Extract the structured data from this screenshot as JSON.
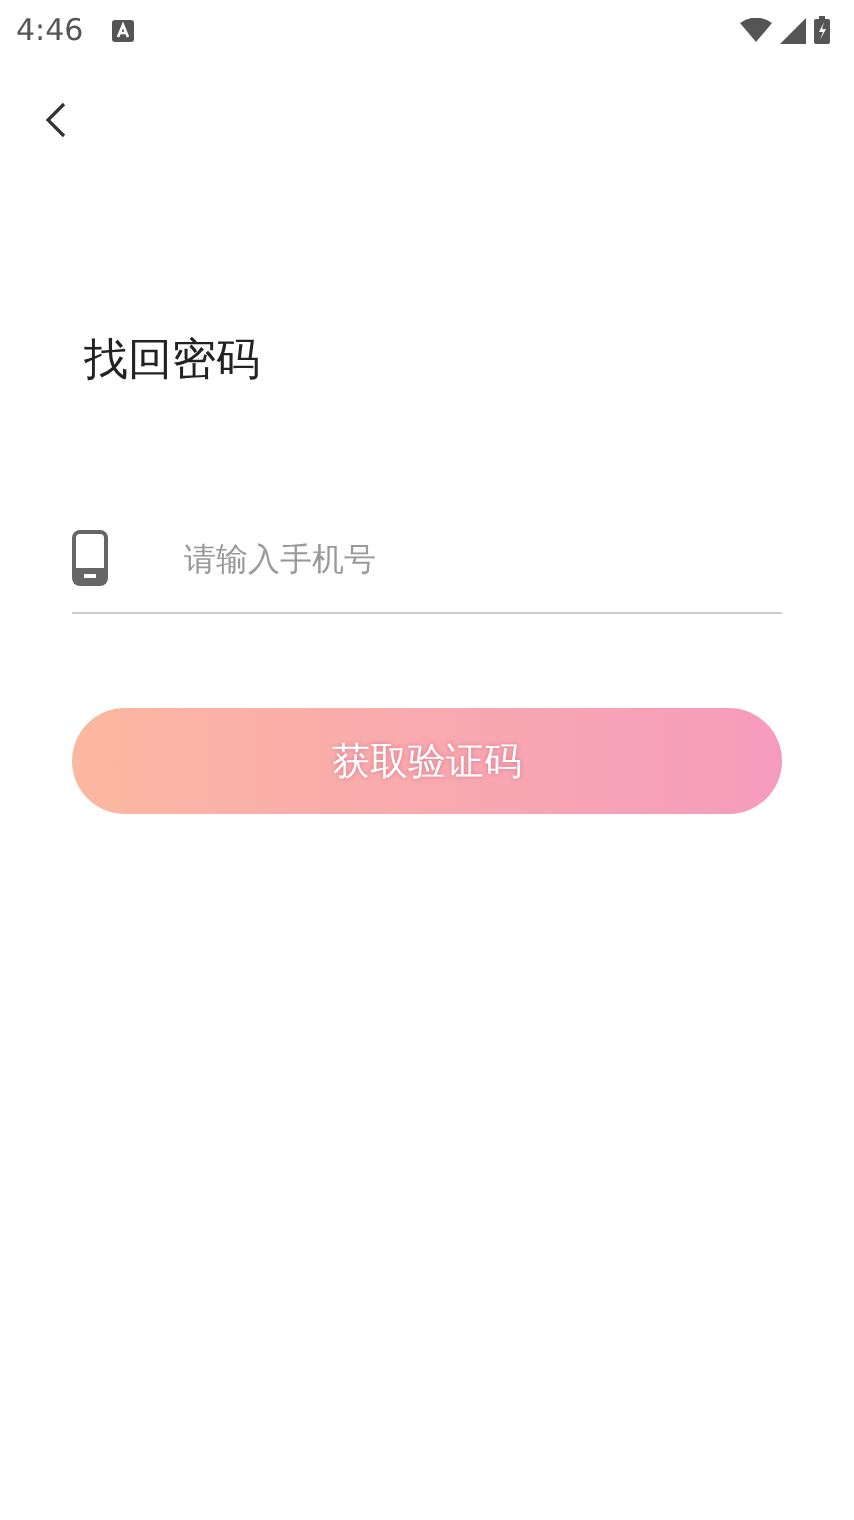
{
  "status_bar": {
    "time": "4:46"
  },
  "title": "找回密码",
  "phone_field": {
    "placeholder": "请输入手机号"
  },
  "submit_button": {
    "label": "获取验证码",
    "disabled": true
  }
}
